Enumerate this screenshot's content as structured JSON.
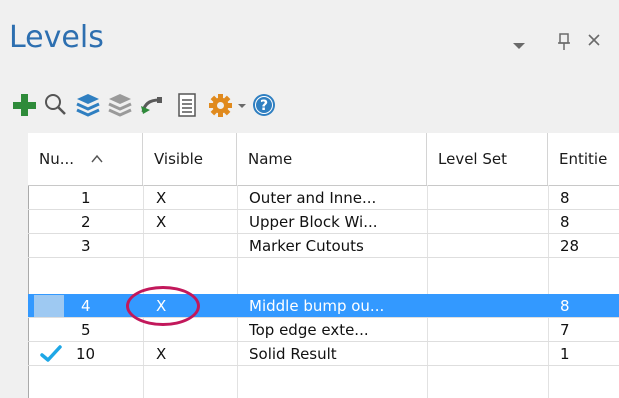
{
  "panel": {
    "title": "Levels",
    "dropdown_icon": "chevron-down-icon",
    "pin_glyph": "□",
    "close_glyph": "✕"
  },
  "toolbar": {
    "icons": [
      "add-icon",
      "search-icon",
      "layers-icon",
      "layers-gray-icon",
      "undo-arrow-icon",
      "document-icon",
      "gear-icon",
      "dropdown-arrow-icon",
      "help-icon"
    ]
  },
  "table": {
    "columns": [
      "Nu...",
      "Visible",
      "Name",
      "Level Set",
      "Entitie"
    ],
    "sort_indicator": "^",
    "rows": [
      {
        "number": "1",
        "visible": "X",
        "name": "Outer and Inne...",
        "level_set": "",
        "entities": "8"
      },
      {
        "number": "2",
        "visible": "X",
        "name": "Upper Block Wi...",
        "level_set": "",
        "entities": "8"
      },
      {
        "number": "3",
        "visible": "",
        "name": "Marker Cutouts",
        "level_set": "",
        "entities": "28"
      },
      {
        "number": "4",
        "visible": "X",
        "name": "Middle bump ou...",
        "level_set": "",
        "entities": "8"
      },
      {
        "number": "5",
        "visible": "",
        "name": "Top edge exte...",
        "level_set": "",
        "entities": "7"
      },
      {
        "number": "10",
        "visible": "X",
        "name": "Solid Result",
        "level_set": "",
        "entities": "1"
      }
    ]
  },
  "colors": {
    "title": "#2d6fb0",
    "selection": "#3399ff",
    "annotation_ring": "#c2185b",
    "checkmark": "#1ea7e6",
    "add_icon": "#2e8b3a"
  }
}
